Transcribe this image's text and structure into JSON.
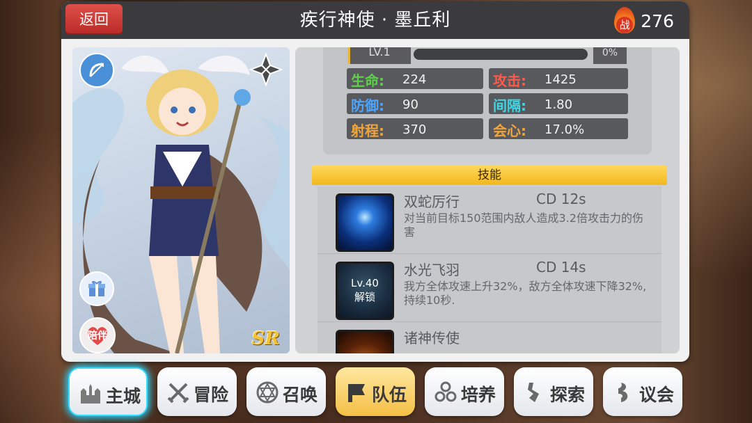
{
  "header": {
    "back_label": "返回",
    "title": "疾行神使 · 墨丘利",
    "power_badge": "战",
    "power_value": "276"
  },
  "portrait": {
    "class_icon": "bow-icon",
    "element_icon": "shuriken-icon",
    "gift_icon": "gift-icon",
    "companion_label": "陪伴",
    "rarity": "SR"
  },
  "level": {
    "label": "LV.1",
    "exp_fraction": 0.0,
    "exp_percent_label": "0%"
  },
  "stats": [
    {
      "label": "生命:",
      "value": "224",
      "color": "#5fcf4e"
    },
    {
      "label": "攻击:",
      "value": "1425",
      "color": "#ff5a4c"
    },
    {
      "label": "防御:",
      "value": "90",
      "color": "#4aa6ff"
    },
    {
      "label": "间隔:",
      "value": "1.80",
      "color": "#3fd6e6"
    },
    {
      "label": "射程:",
      "value": "370",
      "color": "#f2a53a"
    },
    {
      "label": "会心:",
      "value": "17.0%",
      "color": "#f2a53a"
    }
  ],
  "skills": {
    "header": "技能",
    "items": [
      {
        "name": "双蛇厉行",
        "cd": "CD  12s",
        "desc": "对当前目标150范围内敌人造成3.2倍攻击力的伤害",
        "locked": false
      },
      {
        "name": "水光飞羽",
        "cd": "CD  14s",
        "desc": "我方全体攻速上升32%，敌方全体攻速下降32%,持续10秒.",
        "locked": true,
        "lock_level": "Lv.40",
        "lock_text": "解锁"
      },
      {
        "name": "诸神传使",
        "cd": "",
        "desc": "",
        "locked": false
      }
    ]
  },
  "nav": [
    {
      "label": "主城",
      "icon": "castle-icon"
    },
    {
      "label": "冒险",
      "icon": "crossed-swords-icon"
    },
    {
      "label": "召唤",
      "icon": "summon-circle-icon"
    },
    {
      "label": "队伍",
      "icon": "team-flag-icon"
    },
    {
      "label": "培养",
      "icon": "nurture-icon"
    },
    {
      "label": "探索",
      "icon": "explore-icon"
    },
    {
      "label": "议会",
      "icon": "council-icon"
    }
  ]
}
